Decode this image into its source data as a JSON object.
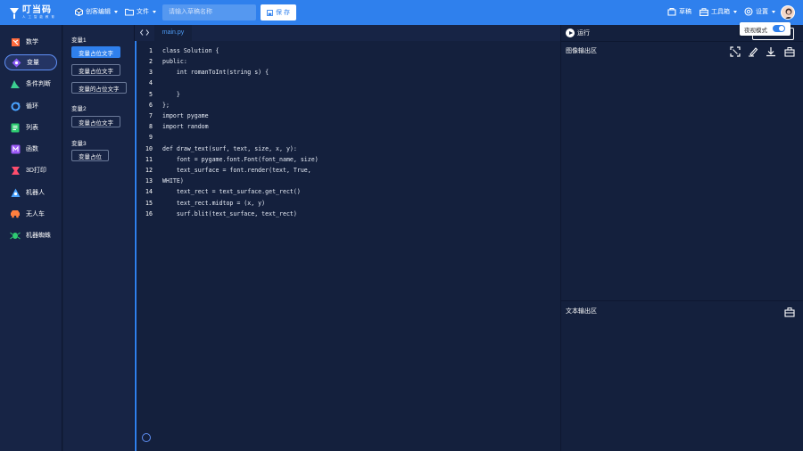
{
  "header": {
    "logo_main": "叮当码",
    "logo_sub": "人 工 智 能 教 育",
    "menus": [
      "创客编辑",
      "文件"
    ],
    "search_placeholder": "请输入草稿名称",
    "save_label": "保 存",
    "right_menus": [
      "草稿",
      "工具箱",
      "设置"
    ]
  },
  "sidebar": {
    "items": [
      {
        "label": "数学",
        "icon": "math-icon",
        "color": "#ff6a3d"
      },
      {
        "label": "变量",
        "icon": "variable-icon",
        "color": "#8a5cf5",
        "active": true
      },
      {
        "label": "条件判断",
        "icon": "condition-icon",
        "color": "#3ccf91"
      },
      {
        "label": "循环",
        "icon": "loop-icon",
        "color": "#4aa3ff"
      },
      {
        "label": "列表",
        "icon": "list-icon",
        "color": "#2ecc71"
      },
      {
        "label": "函数",
        "icon": "function-icon",
        "color": "#9b59f6"
      },
      {
        "label": "3D打印",
        "icon": "3d-print-icon",
        "color": "#ff4d6d"
      },
      {
        "label": "机器人",
        "icon": "robot-icon",
        "color": "#4aa3ff"
      },
      {
        "label": "无人车",
        "icon": "car-icon",
        "color": "#ff7f3f"
      },
      {
        "label": "机器蜘蛛",
        "icon": "spider-icon",
        "color": "#2ecc71"
      }
    ]
  },
  "variables": {
    "groups": [
      {
        "title": "变量1",
        "buttons": [
          "变量占位文字",
          "变量占位文字",
          "变量的占位文字"
        ]
      },
      {
        "title": "变量2",
        "buttons": [
          "变量占位文字"
        ]
      },
      {
        "title": "变量3",
        "buttons": [
          "变量占位"
        ]
      }
    ]
  },
  "editor": {
    "tab": "main.py",
    "line_numbers": [
      "1",
      "2",
      "3",
      "4",
      "5",
      "6",
      "7",
      "8",
      "9",
      "10",
      "11",
      "12",
      "13",
      "14",
      "15",
      "16"
    ],
    "lines": [
      "class Solution {",
      "public:",
      "    int romanToInt(string s) {",
      "",
      "    }",
      "};",
      "import pygame",
      "import random",
      "",
      "def draw_text(surf, text, size, x, y):",
      "    font = pygame.font.Font(font_name, size)",
      "    text_surface = font.render(text, True,",
      "WHITE)",
      "    text_rect = text_surface.get_rect()",
      "    text_rect.midtop = (x, y)",
      "    surf.blit(text_surface, text_rect)"
    ]
  },
  "output": {
    "run_label": "运行",
    "image_output_label": "图像输出区",
    "text_output_label": "文本输出区",
    "night_mode_label": "夜视模式",
    "night_mode_on": true
  },
  "colors": {
    "accent": "#2f80ed",
    "background": "#14203d",
    "panel": "#172445"
  }
}
